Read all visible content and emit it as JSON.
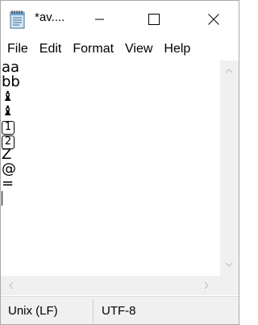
{
  "window": {
    "title": "*av....",
    "minimize_glyph": "minimize-icon",
    "maximize_glyph": "maximize-icon",
    "close_glyph": "close-icon"
  },
  "menu": {
    "items": [
      "File",
      "Edit",
      "Format",
      "View",
      "Help"
    ]
  },
  "editor": {
    "lines": [
      {
        "kind": "text",
        "text": "aa"
      },
      {
        "kind": "text",
        "text": "bb"
      },
      {
        "kind": "pawn",
        "text": "♝"
      },
      {
        "kind": "pawn",
        "text": "♝"
      },
      {
        "kind": "boxed",
        "text": "1"
      },
      {
        "kind": "boxed",
        "text": "2"
      },
      {
        "kind": "text",
        "text": "Z"
      },
      {
        "kind": "text",
        "text": "@"
      },
      {
        "kind": "text",
        "text": "="
      },
      {
        "kind": "caret",
        "text": ""
      }
    ]
  },
  "status": {
    "line_ending": "Unix (LF)",
    "encoding": "UTF-8"
  }
}
